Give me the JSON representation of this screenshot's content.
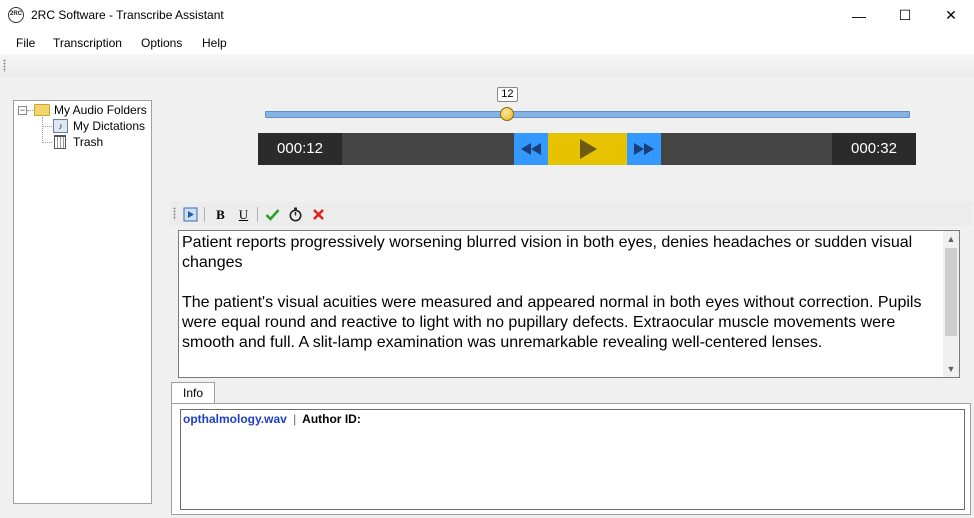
{
  "window": {
    "title": "2RC Software - Transcribe Assistant",
    "app_icon_text": "2RC",
    "minimize_glyph": "—",
    "maximize_glyph": "☐",
    "close_glyph": "✕"
  },
  "menu": {
    "items": [
      "File",
      "Transcription",
      "Options",
      "Help"
    ]
  },
  "tree": {
    "root": {
      "label": "My Audio Folders",
      "expander": "−"
    },
    "children": [
      {
        "label": "My Dictations"
      },
      {
        "label": "Trash"
      }
    ]
  },
  "player": {
    "position_seconds": 12,
    "duration_seconds": 32,
    "position_label": "12",
    "elapsed": "000:12",
    "total": "000:32",
    "colors": {
      "rewind": "#3399ff",
      "play": "#e6c200",
      "forward": "#3399ff"
    }
  },
  "editor_toolbar": {
    "bold": "B",
    "underline": "U",
    "icons": [
      "insert-audio-icon",
      "bold-icon",
      "underline-icon",
      "checkmark-icon",
      "timer-icon",
      "delete-x-icon"
    ]
  },
  "editor": {
    "paragraphs": [
      "Patient reports progressively worsening blurred vision in both eyes, denies headaches or sudden visual changes",
      "The patient's visual acuities were measured and appeared normal in both eyes without correction. Pupils were equal round and reactive to light with no pupillary defects. Extraocular muscle movements were smooth and full. A slit-lamp examination was unremarkable revealing well-centered lenses."
    ]
  },
  "info": {
    "tab_label": "Info",
    "filename": "opthalmology.wav",
    "separator": "|",
    "author_label": "Author ID:"
  }
}
